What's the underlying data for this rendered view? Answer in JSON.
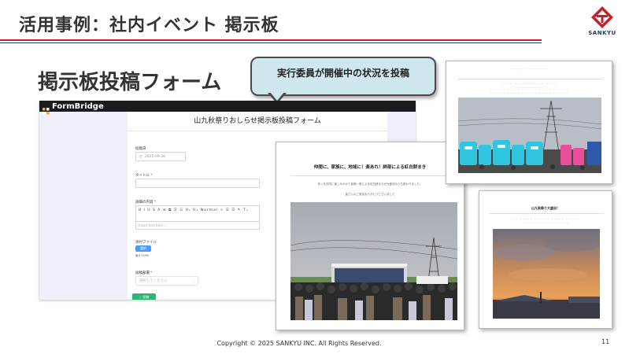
{
  "slide": {
    "title": "活用事例：社内イベント 掲示板",
    "section_heading": "掲示板投稿フォーム",
    "callout": "実行委員が開催中の状況を投稿",
    "footer": "Copyright © 2025 SANKYU INC. All Rights Reserved.",
    "page_number": "11"
  },
  "logo": {
    "text": "SANKYU",
    "icon": "sankyu-logo-icon",
    "red": "#c8202a",
    "blue": "#1f3a7a"
  },
  "form": {
    "brand": "FormBridge",
    "title": "山九秋祭りおしらせ掲示板投稿フォーム",
    "fields": {
      "date_label": "投稿日",
      "date_value": "2025-09-30",
      "title_label": "タイトル",
      "content_label": "詳細の内容",
      "editor_toolbar": "B I U S A ≡ ⧉ ☰ ☷ H₁ H₂ Normal ÷ ☰ ☰ ✎ Tₓ",
      "editor_placeholder": "Insert text here ...",
      "file_label": "添付ファイル",
      "file_button": "選択",
      "file_note": "最大10MB",
      "author_label": "投稿部署",
      "author_placeholder": "選択してください"
    },
    "submit_label": "✓ 投稿",
    "accent": "#2bb673"
  },
  "posts": {
    "main": {
      "title": "仲間に、家族に、地域に！楽あれ！絆部による紅白餅まき",
      "line1": "多くを共同に楽しみかけて参照一堂による紅白餅まきが大盛況のうち終わりました。",
      "line2": "皆さんのご参加ありがとうございました"
    },
    "top_right": {
      "title": "・・・・・・ ・・ ・・・・・ ・・・",
      "line1": "・・・・・・・・・・・・・・・・・・・・・・・・・・・・",
      "line2": "・・・・・・・・・・・・・・・",
      "line3": "・・・・・・・・・・・・・・・・・・・・・・・・・・・・・・・・・・・・・・・・"
    },
    "bottom_right": {
      "title": "山九秋祭り大盛況！",
      "line1": "・・・・・・・・・・・・・・・・・・・・・・・・・・・・・・・・・・",
      "line2": "・・・・・・・・・・・・・・・・・・・・・・・"
    }
  }
}
